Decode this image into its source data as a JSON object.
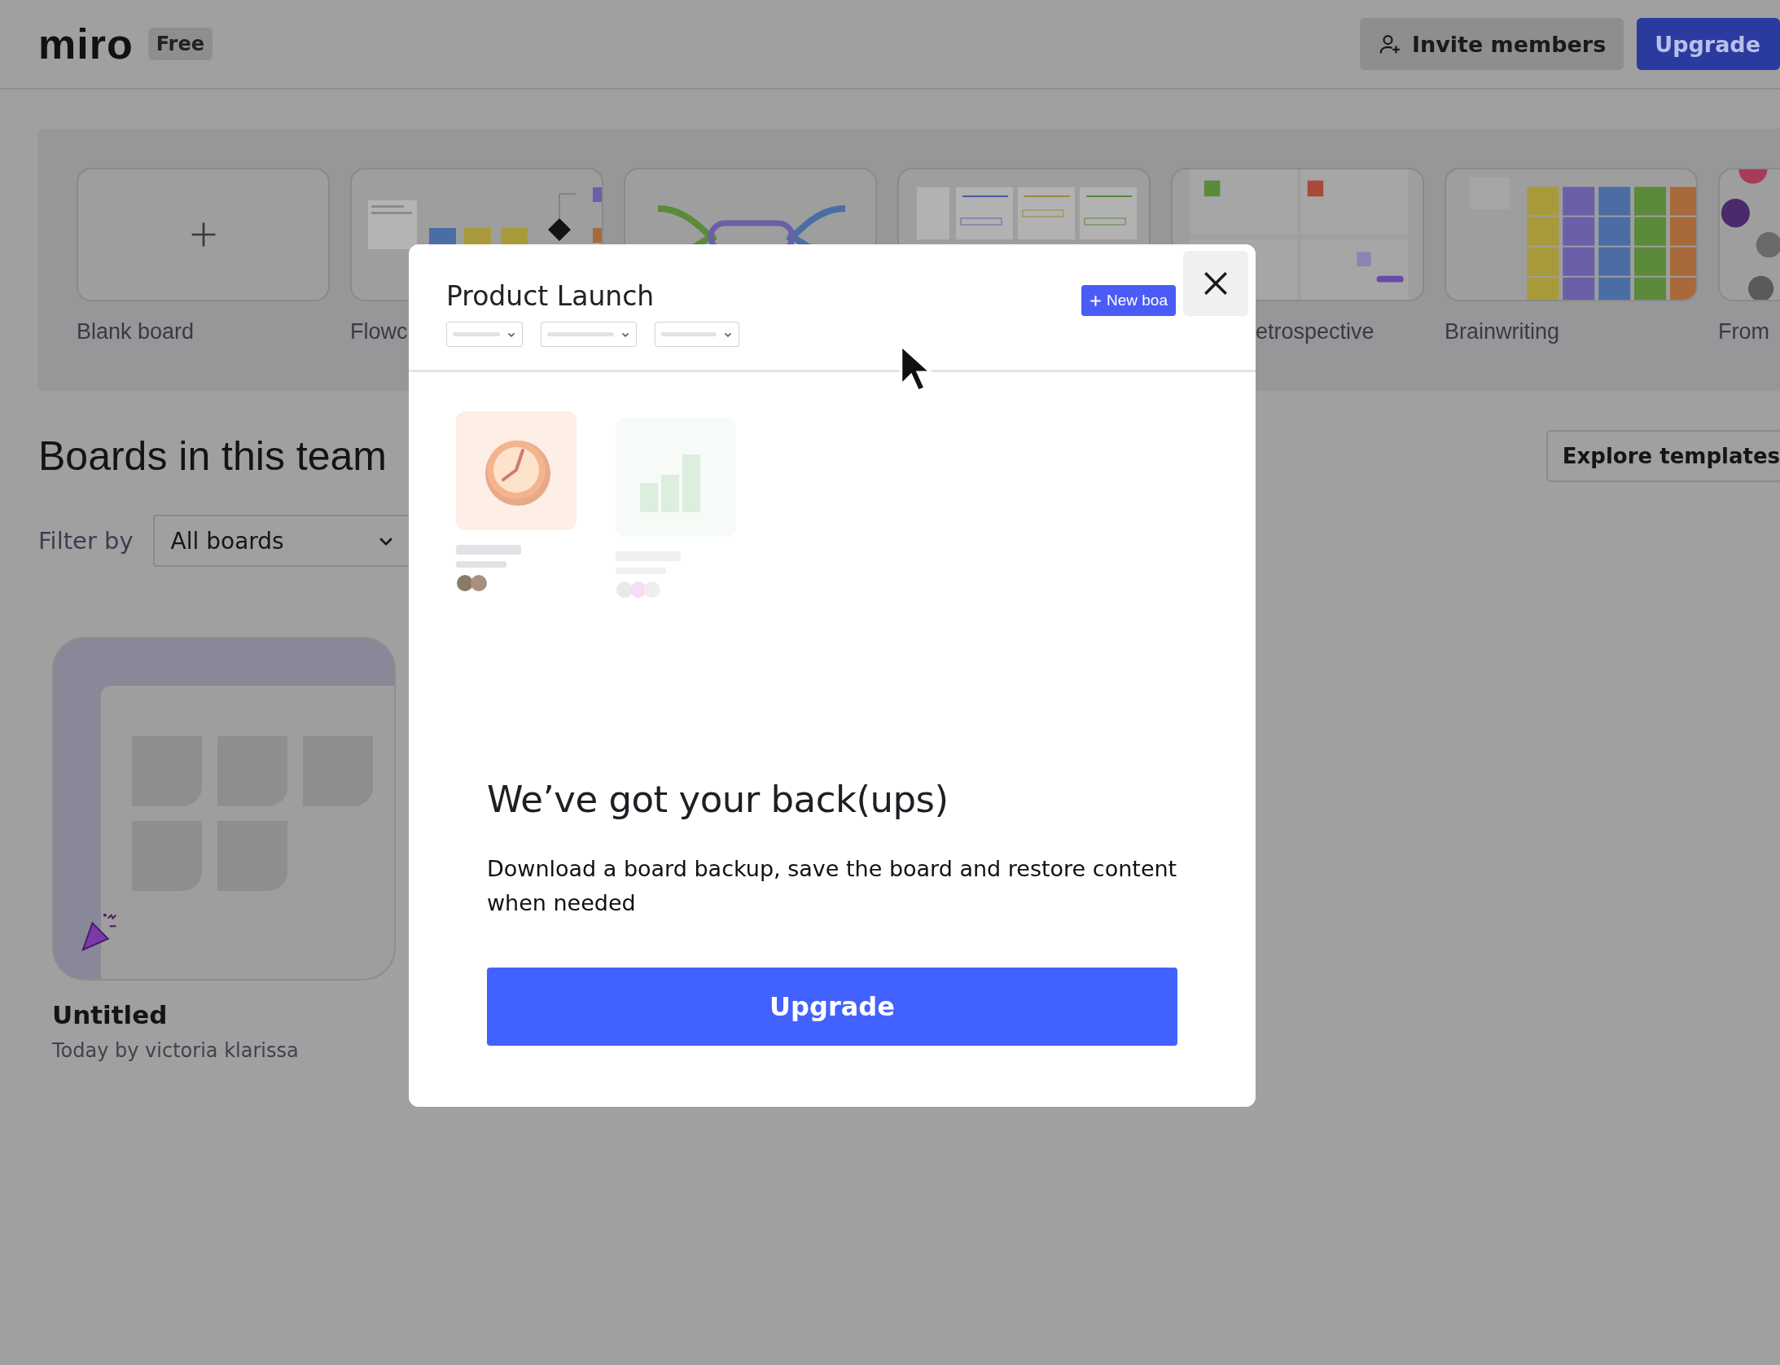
{
  "header": {
    "logo": "miro",
    "plan_badge": "Free",
    "buttons": [
      {
        "label": "Invite members",
        "kind": "secondary"
      },
      {
        "label": "Upgrade",
        "kind": "primary"
      }
    ]
  },
  "templates": [
    {
      "kind": "blank",
      "label": "Blank board"
    },
    {
      "kind": "flowchart",
      "label": "Flowc"
    },
    {
      "kind": "mindmap"
    },
    {
      "kind": "kanban"
    },
    {
      "kind": "retrospective",
      "label": "etrospective"
    },
    {
      "kind": "brainwriting",
      "label": "Brainwriting"
    },
    {
      "kind": "people",
      "label": "From"
    }
  ],
  "section": {
    "title": "Boards in this team",
    "explore_button": "Explore templates",
    "filter_label": "Filter by",
    "filter_value": "All boards"
  },
  "boards": [
    {
      "title": "Untitled",
      "subtitle": "Today by victoria klarissa"
    }
  ],
  "modal": {
    "board_title": "Product Launch",
    "new_board_button": "New boa",
    "heading": "We’ve got your back(ups)",
    "body": "Download a board backup, save the board and restore content when needed",
    "cta": "Upgrade"
  }
}
